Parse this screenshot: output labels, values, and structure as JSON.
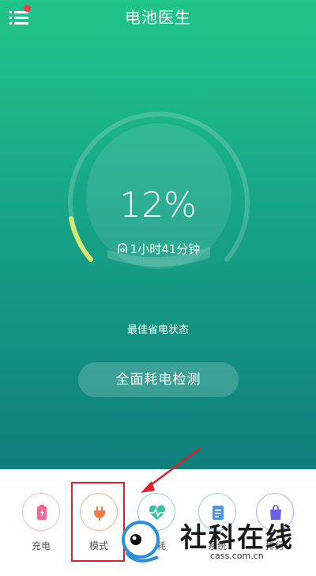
{
  "header": {
    "title": "电池医生"
  },
  "battery": {
    "percent_text": "12%",
    "level": 0.12,
    "remaining_time": "1小时41分钟"
  },
  "status_text": "最佳省电状态",
  "actions": {
    "full_check_label": "全面耗电检测"
  },
  "tabs": [
    {
      "label": "充电",
      "icon": "battery-charge-icon",
      "color": "#f2b7c9"
    },
    {
      "label": "模式",
      "icon": "plug-icon",
      "color": "#f6b08f"
    },
    {
      "label": "损耗",
      "icon": "heartbeat-icon",
      "color": "#8fd6c9"
    },
    {
      "label": "系统",
      "icon": "document-icon",
      "color": "#9cc7f0"
    },
    {
      "label": "排行",
      "icon": "bag-icon",
      "color": "#b3aef0"
    }
  ],
  "watermark": {
    "brand": "社科在线",
    "url": "cass.com.cn"
  },
  "colors": {
    "header_green": "#20c589",
    "bottom_teal": "#0f7e7b",
    "battery_arc": "#d6ea73",
    "highlight_red": "#e0202a"
  }
}
